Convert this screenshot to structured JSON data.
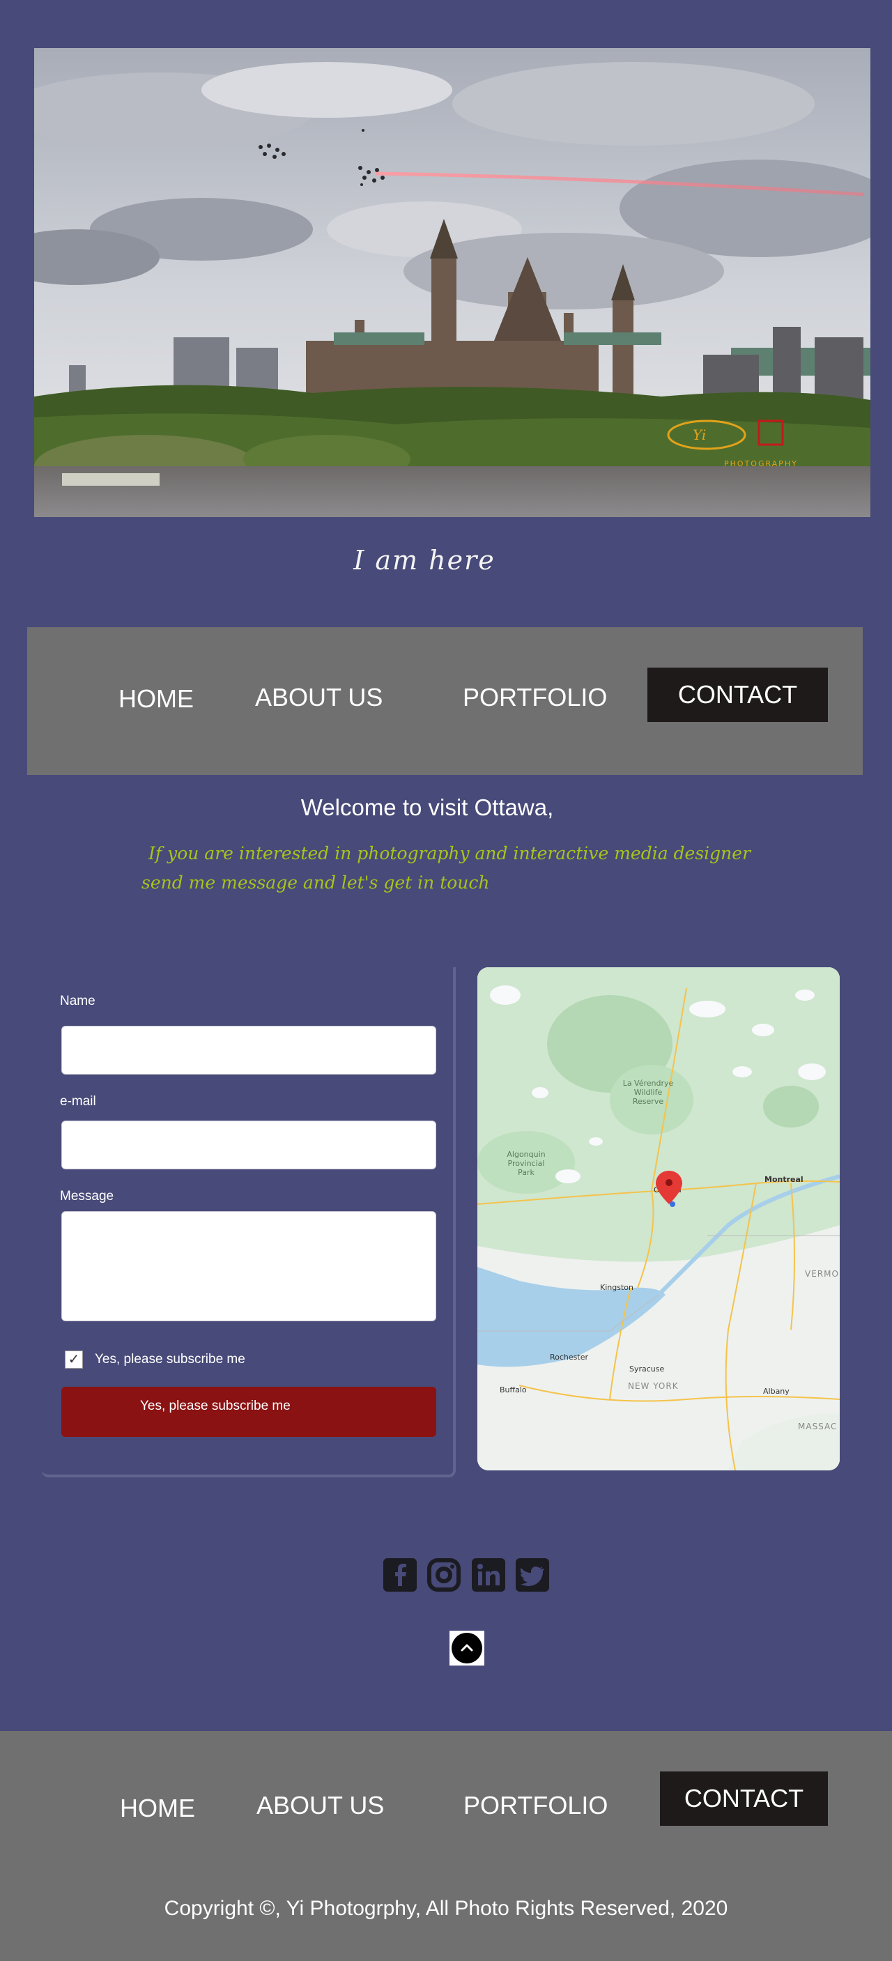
{
  "hero": {
    "alt": "Parliament Hill, Ottawa with jet formation and red smoke trail",
    "watermark": "Yi PHOTOGRAPHY"
  },
  "tagline": "I am here",
  "nav": {
    "items": [
      {
        "label": "HOME"
      },
      {
        "label": "ABOUT US"
      },
      {
        "label": "PORTFOLIO"
      },
      {
        "label": "CONTACT",
        "active": true
      }
    ]
  },
  "welcome": {
    "title": "Welcome to visit Ottawa,",
    "line1": "If you are interested in photography and interactive media designer",
    "line2": "send me message and let's get in touch"
  },
  "form": {
    "name_label": "Name",
    "email_label": "e-mail",
    "message_label": "Message",
    "name_value": "",
    "email_value": "",
    "message_value": "",
    "checkbox_label": "Yes, please subscribe me",
    "checkbox_checked": true,
    "submit_label": "Yes, please subscribe me"
  },
  "map": {
    "labels": {
      "la_verendrye": "La Vérendrye\nWildlife\nReserve",
      "algonquin": "Algonquin\nProvincial\nPark",
      "ottawa": "Ottawa",
      "montreal": "Montreal",
      "kingston": "Kingston",
      "syracuse": "Syracuse",
      "rochester": "Rochester",
      "buffalo": "Buffalo",
      "albany": "Albany",
      "new_york": "NEW YORK",
      "vermont": "VERMO",
      "massachusetts": "MASSAC"
    }
  },
  "social": {
    "icons": [
      "facebook-icon",
      "instagram-icon",
      "linkedin-icon",
      "twitter-icon"
    ]
  },
  "footer": {
    "copyright": "Copyright ©, Yi Photogrphy, All Photo Rights Reserved, 2020"
  },
  "colors": {
    "background": "#484a79",
    "nav": "#707070",
    "active_tab": "#1e1a1a",
    "intro_text": "#a7c31c",
    "submit": "#8a1212"
  }
}
